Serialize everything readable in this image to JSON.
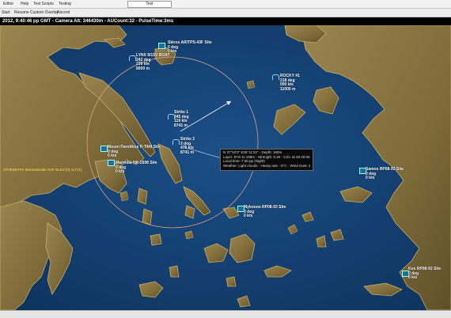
{
  "menu": {
    "items": [
      {
        "label": "Editor"
      },
      {
        "label": "Help"
      },
      {
        "label": "Test Scripts"
      },
      {
        "label": "Testing"
      }
    ],
    "center_button": "Test"
  },
  "toolbar": {
    "items": [
      {
        "label": "Start"
      },
      {
        "label": "Resume"
      },
      {
        "label": "Custom Overlay"
      },
      {
        "label": "Record"
      }
    ]
  },
  "status": {
    "text": "2012, 9:40:46 pp GMT - Camera Alt: 346430m - AUCount:32 - PulseTime:3ms"
  },
  "targets": [
    {
      "lines": [
        "Skiros AR/TPS-43F Site",
        "0 deg",
        "0 kts"
      ]
    },
    {
      "lines": [
        "LYNX 9/15V BOAT",
        "242 deg",
        "239 kts",
        "8000 m"
      ]
    },
    {
      "lines": [
        "ROCKY #1",
        "218 deg",
        "000 kts",
        "11000 m"
      ]
    },
    {
      "lines": [
        "Strike 1",
        "345 deg",
        "119 kts",
        "8741 m"
      ]
    },
    {
      "lines": [
        "Strike 2",
        "3 deg",
        "475 kts",
        "8741 m"
      ]
    },
    {
      "lines": [
        "Mount Parnithos P-TAM Site",
        "0 deg",
        "0 kts"
      ]
    },
    {
      "lines": [
        "Marnidia HK-2608 Site",
        "0 deg",
        "0 kts"
      ]
    },
    {
      "lines": [
        "Mykonos RP08-93 Site",
        "0 deg",
        "0 kts"
      ]
    },
    {
      "lines": [
        "Samos RP08-93 Site",
        "0 deg",
        "0 kts"
      ]
    },
    {
      "lines": [
        "Kos RP08-93 Site",
        "0 deg",
        "0 kts"
      ]
    }
  ],
  "info_box": {
    "lines": [
      "N 37°52'0\" E25°11'22\" - Depth: 160m",
      "Layer: 87m to 198m - Strength: 0.40 - CZs: at 28 00:00 / 110m",
      "Local time: 7:40 pp (Night)",
      "Weather: Light clouds - Heavy rain - 0°C - Wind Gust: 2"
    ]
  },
  "left_label": "ATHENS PHI Mountainside RAF ELEV:(3) ALT:(1)",
  "colors": {
    "sea": "#123f72",
    "sea_shallow": "#1e5a92",
    "land": "#8f7a45",
    "land_dark": "#6d5a2f",
    "coast": "#c9ad66",
    "range_ring": "#d9a48a",
    "bearing_line": "#e8e8f0"
  }
}
